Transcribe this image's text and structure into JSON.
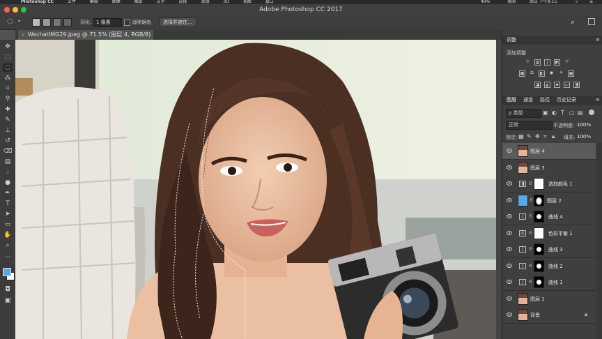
{
  "menubar": {
    "app_name": "Photoshop CC",
    "items": [
      "文件",
      "编辑",
      "图像",
      "图层",
      "文字",
      "选择",
      "滤镜",
      "3D",
      "视图",
      "窗口"
    ],
    "battery": "49%",
    "region": "美国",
    "datetime": "周日 下午8:15"
  },
  "window": {
    "title": "Adobe Photoshop CC 2017"
  },
  "options": {
    "feather_label": "羽化:",
    "feather_value": "1 像素",
    "antialias_label": "消除锯齿",
    "select_mask_button": "选择并遮住..."
  },
  "document": {
    "tab_label": "WechatIMG29.jpeg @ 71.5% (图层 4, RGB/8) *"
  },
  "adjustments": {
    "title": "调整",
    "add_label": "添加调整"
  },
  "layers_panel": {
    "tabs": [
      "图层",
      "通道",
      "路径",
      "历史记录"
    ],
    "filter_label": "ρ 类型",
    "blend_mode": "正常",
    "opacity_label": "不透明度:",
    "opacity_value": "100%",
    "lock_label": "锁定:",
    "fill_label": "填充:",
    "fill_value": "100%",
    "layers": [
      {
        "name": "图层 4",
        "selected": true,
        "kind": "photo"
      },
      {
        "name": "图层 3",
        "selected": false,
        "kind": "photo"
      },
      {
        "name": "选取颜色 1",
        "selected": false,
        "kind": "adjust-white"
      },
      {
        "name": "图层 2",
        "selected": false,
        "kind": "blue"
      },
      {
        "name": "曲线 4",
        "selected": false,
        "kind": "curve-mask"
      },
      {
        "name": "色彩平衡 1",
        "selected": false,
        "kind": "balance-white"
      },
      {
        "name": "曲线 3",
        "selected": false,
        "kind": "curve-mask"
      },
      {
        "name": "曲线 2",
        "selected": false,
        "kind": "curve-mask"
      },
      {
        "name": "曲线 1",
        "selected": false,
        "kind": "curve-mask"
      },
      {
        "name": "图层 1",
        "selected": false,
        "kind": "photo"
      },
      {
        "name": "背景",
        "selected": false,
        "kind": "photo-locked"
      }
    ]
  },
  "colors": {
    "foreground": "#5aa7e6",
    "background": "#ffffff",
    "layer2_fill": "#5aa7e6"
  }
}
